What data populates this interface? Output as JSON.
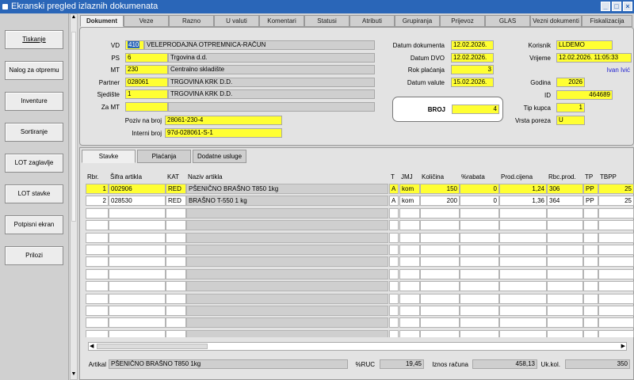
{
  "window": {
    "title": "Ekranski pregled izlaznih dokumenata",
    "controls": [
      "_",
      "□",
      "×"
    ]
  },
  "side_buttons": [
    "Tiskanje",
    "Nalog za otpremu",
    "Inventure",
    "Sortiranje",
    "LOT zaglavlje",
    "LOT stavke",
    "Potpisni ekran",
    "Prilozi"
  ],
  "tabs": [
    "Dokument",
    "Veze",
    "Razno",
    "U valuti",
    "Komentari",
    "Statusi",
    "Atributi",
    "Grupiranja",
    "Prijevoz",
    "GLAS",
    "Vezni dokumenti",
    "Fiskalizacija"
  ],
  "header": {
    "vd_label": "VD",
    "vd_code": "410",
    "vd_name": "VELEPRODAJNA OTPREMNICA-RAČUN",
    "ps_label": "PS",
    "ps_code": "6",
    "ps_name": "Trgovina d.d.",
    "mt_label": "MT",
    "mt_code": "230",
    "mt_name": "Centralno skladište",
    "partner_label": "Partner",
    "partner_code": "028061",
    "partner_name": "TRGOVINA KRK D.D.",
    "sjediste_label": "Sjedište",
    "sjediste_code": "1",
    "sjediste_name": "TRGOVINA KRK D.D.",
    "zamt_label": "Za MT",
    "zamt_code": "",
    "zamt_name": "",
    "poziv_label": "Poziv na broj",
    "poziv_value": "28061-230-4",
    "interni_label": "Interni broj",
    "interni_value": "97d-028061-S-1",
    "datum_dok_label": "Datum dokumenta",
    "datum_dok": "12.02.2026.",
    "datum_dvo_label": "Datum DVO",
    "datum_dvo": "12.02.2026.",
    "rok_label": "Rok plaćanja",
    "rok": "3",
    "datum_val_label": "Datum valute",
    "datum_val": "15.02.2026.",
    "broj_label": "BROJ",
    "broj": "4",
    "korisnik_label": "Korisnik",
    "korisnik": "LLDEMO",
    "vrijeme_label": "Vrijeme",
    "vrijeme": "12.02.2026. 11:05:33",
    "user_name": "Ivan Ivić",
    "godina_label": "Godina",
    "godina": "2026",
    "id_label": "ID",
    "id": "464689",
    "tip_kupca_label": "Tip kupca",
    "tip_kupca": "1",
    "vrsta_poreza_label": "Vrsta poreza",
    "vrsta_poreza": "U"
  },
  "subtabs": [
    "Stavke",
    "Plaćanja",
    "Dodatne usluge"
  ],
  "grid": {
    "columns": [
      "Rbr.",
      "Šifra artikla",
      "KAT",
      "Naziv artikla",
      "T",
      "JMJ",
      "Količina",
      "%rabata",
      "Prod.cijena",
      "Rbc.prod.",
      "TP",
      "TBPP"
    ],
    "rows": [
      [
        "1",
        "002906",
        "RED",
        "PŠENIČNO BRAŠNO T850 1kg",
        "A",
        "kom",
        "150",
        "0",
        "1,24",
        "306",
        "PP",
        "25"
      ],
      [
        "2",
        "028530",
        "RED",
        "BRAŠNO T-550 1 kg",
        "A",
        "kom",
        "200",
        "0",
        "1,36",
        "364",
        "PP",
        "25"
      ]
    ]
  },
  "footer": {
    "artikal_label": "Artikal",
    "artikal": "PŠENIČNO BRAŠNO T850 1kg",
    "ruc_label": "%RUC",
    "ruc": "19,45",
    "iznos_label": "Iznos računa",
    "iznos": "458,13",
    "ukkol_label": "Uk.kol.",
    "ukkol": "350"
  },
  "colors": {
    "titlebar": "#2a66b8",
    "highlight": "#ffff33",
    "user_name": "#2020d0"
  }
}
